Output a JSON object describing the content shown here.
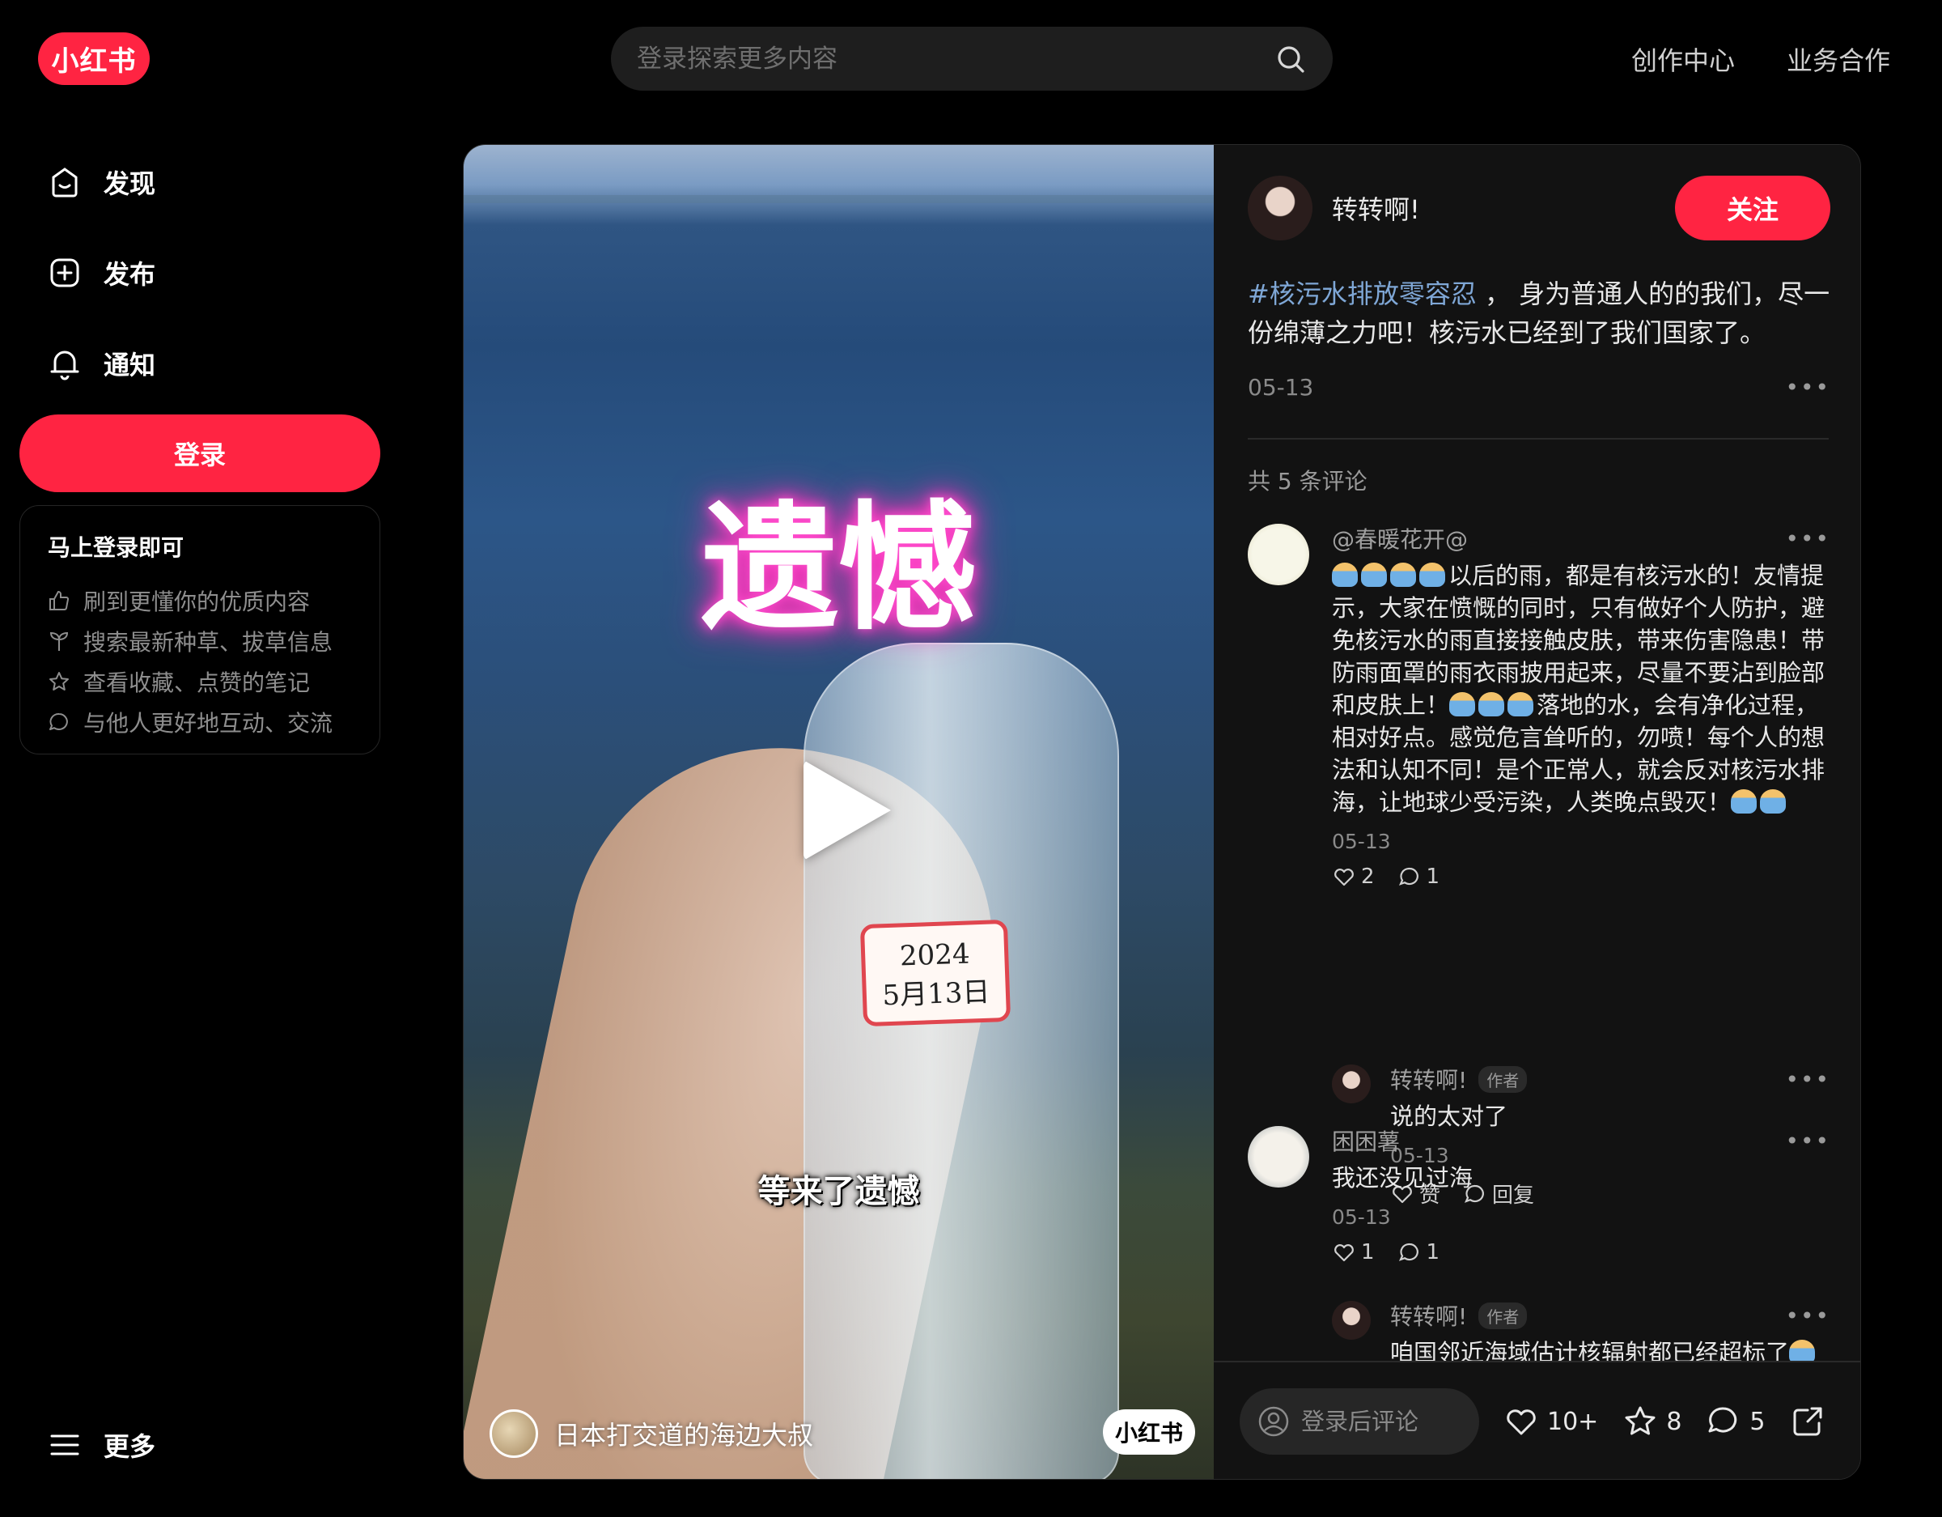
{
  "brand": {
    "logo_text": "小红书",
    "color": "#ff2442"
  },
  "search": {
    "placeholder": "登录探索更多内容"
  },
  "top_links": [
    "创作中心",
    "业务合作"
  ],
  "nav": {
    "items": [
      {
        "label": "发现",
        "icon": "home-icon"
      },
      {
        "label": "发布",
        "icon": "plus-square-icon"
      },
      {
        "label": "通知",
        "icon": "bell-icon"
      }
    ],
    "login_label": "登录",
    "more_label": "更多"
  },
  "login_card": {
    "title": "马上登录即可",
    "benefits": [
      {
        "text": "刷到更懂你的优质内容",
        "icon": "thumb-up-icon"
      },
      {
        "text": "搜索最新种草、拔草信息",
        "icon": "sprout-icon"
      },
      {
        "text": "查看收藏、点赞的笔记",
        "icon": "star-icon"
      },
      {
        "text": "与他人更好地互动、交流",
        "icon": "chat-icon"
      }
    ]
  },
  "media": {
    "overlay_title": "遗憾",
    "date_tag_line1": "2024",
    "date_tag_line2": "5月13日",
    "subtitle": "等来了遗憾",
    "author": "日本打交道的海边大叔",
    "watermark": "小红书"
  },
  "note": {
    "author": "转转啊!",
    "follow_label": "关注",
    "hashtag": "#核污水排放零容忍",
    "desc": " ， 身为普通人的的我们，尽一份绵薄之力吧！核污水已经到了我们国家了。",
    "date": "05-13",
    "comment_count": "共 5 条评论"
  },
  "comments": [
    {
      "name": "@春暖花开@",
      "text_a": "以后的雨，都是有核污水的！友情提示，大家在愤慨的同时，只有做好个人防护，避免核污水的雨直接接触皮肤，带来伤害隐患！带防雨面罩的雨衣雨披用起来，尽量不要沾到脸部和皮肤上！",
      "text_b": "落地的水，会有净化过程，相对好点。感觉危言耸听的，勿喷！每个人的想法和认知不同！是个正常人，就会反对核污水排海，让地球少受污染，人类晚点毁灭！",
      "date": "05-13",
      "likes": "2",
      "replies": "1",
      "reply": {
        "name": "转转啊!",
        "badge": "作者",
        "text": "说的太对了",
        "date": "05-13",
        "like_label": "赞",
        "reply_label": "回复"
      }
    },
    {
      "name": "困困薯",
      "text": "我还没见过海",
      "date": "05-13",
      "likes": "1",
      "replies": "1",
      "reply": {
        "name": "转转啊!",
        "badge": "作者",
        "text": "咱国邻近海域估计核辐射都已经超标了"
      }
    }
  ],
  "footer": {
    "comment_placeholder": "登录后评论",
    "likes": "10+",
    "collects": "8",
    "comments": "5"
  }
}
